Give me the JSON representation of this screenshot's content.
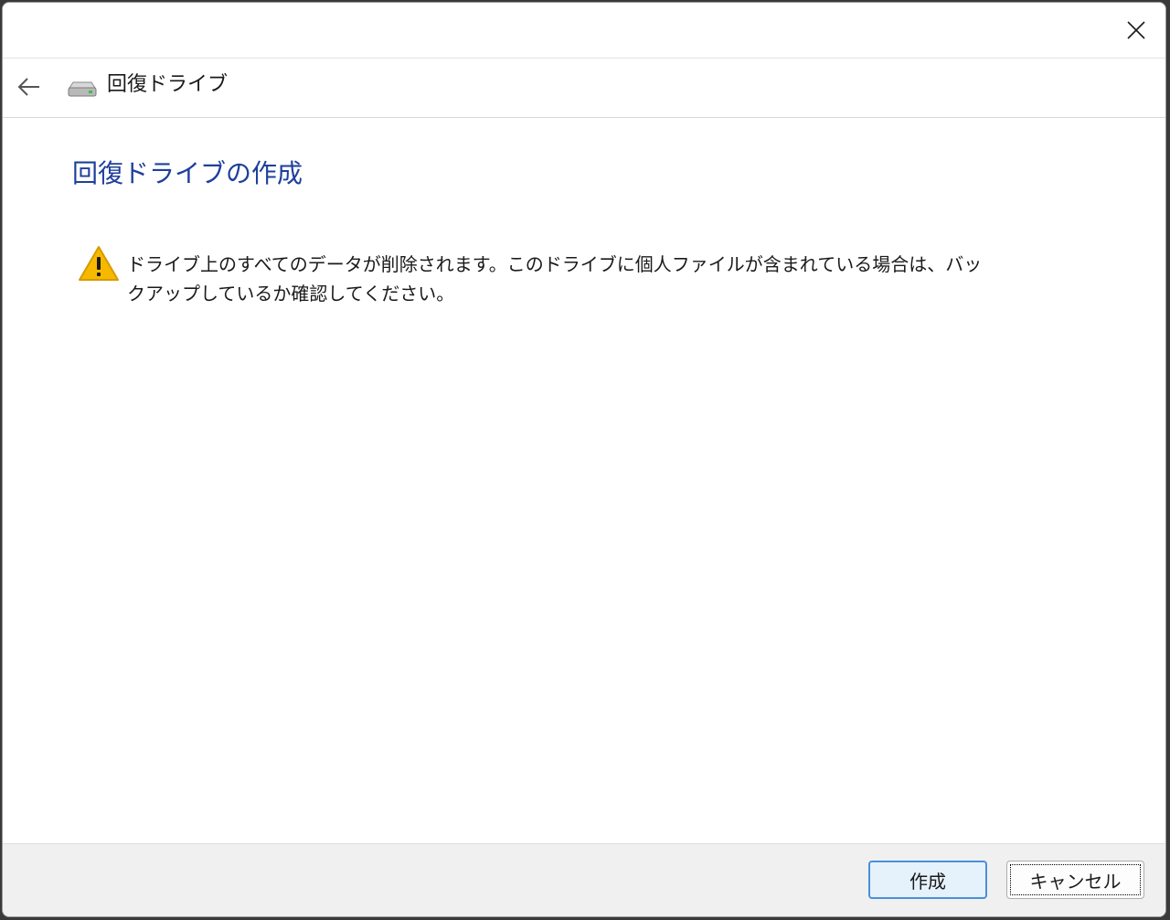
{
  "nav": {
    "title": "回復ドライブ"
  },
  "main": {
    "heading": "回復ドライブの作成",
    "warning_text": "ドライブ上のすべてのデータが削除されます。このドライブに個人ファイルが含まれている場合は、バックアップしているか確認してください。"
  },
  "footer": {
    "create_label": "作成",
    "cancel_label": "キャンセル"
  },
  "colors": {
    "heading": "#1e3f9c",
    "warning_icon": "#f6b900",
    "primary_button_border": "#4a90d9",
    "footer_background": "#f0f0f0"
  },
  "icons": {
    "close": "close-icon",
    "back": "back-arrow-icon",
    "drive": "drive-icon",
    "warning": "warning-icon"
  }
}
